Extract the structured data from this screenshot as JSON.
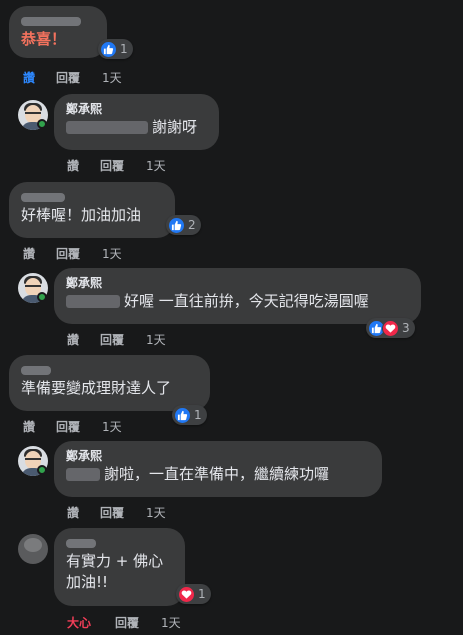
{
  "comments": [
    {
      "name_text": "",
      "body": "恭喜！",
      "reaction_count": "1",
      "like": "讚",
      "reply": "回覆",
      "time": "1天"
    },
    {
      "name_text": "鄭承熙",
      "body": "謝謝呀",
      "reaction_count": "",
      "like": "讚",
      "reply": "回覆",
      "time": "1天"
    },
    {
      "name_text": "",
      "body": "好棒喔！加油加油",
      "reaction_count": "2",
      "like": "讚",
      "reply": "回覆",
      "time": "1天"
    },
    {
      "name_text": "鄭承熙",
      "body": "好喔 一直往前拚，今天記得吃湯圓喔",
      "reaction_count": "3",
      "like": "讚",
      "reply": "回覆",
      "time": "1天"
    },
    {
      "name_text": "",
      "body": "準備要變成理財達人了",
      "reaction_count": "1",
      "like": "讚",
      "reply": "回覆",
      "time": "1天"
    },
    {
      "name_text": "鄭承熙",
      "body": "謝啦，一直在準備中，繼續練功囉",
      "reaction_count": "",
      "like": "讚",
      "reply": "回覆",
      "time": "1天"
    },
    {
      "name_text": "",
      "body_line1": "有實力 + 佛心",
      "body_line2": "加油!!",
      "reaction_count": "1",
      "like": "大心",
      "reply": "回覆",
      "time": "1天"
    }
  ],
  "colors": {
    "background": "#18191a",
    "bubble": "#3a3b3c",
    "like_blue": "#2078f4",
    "love_red": "#f0284a",
    "highlight_red": "#f3725e"
  },
  "icons": [
    "thumbs-up-icon",
    "heart-icon",
    "avatar-icon",
    "online-dot-icon"
  ]
}
